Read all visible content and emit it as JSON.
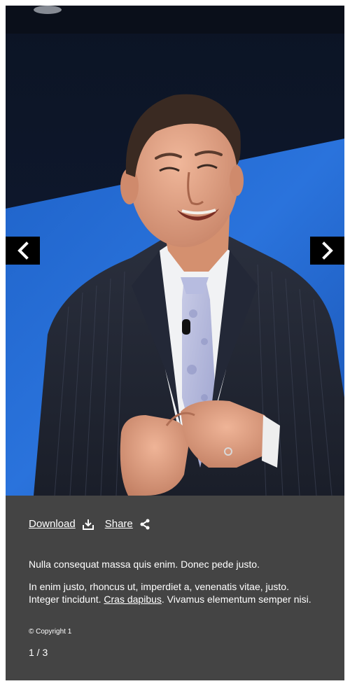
{
  "gallery": {
    "photo_alt": "Man in a pinstripe suit and paisley tie speaking on stage",
    "prev_icon": "chevron-left-icon",
    "next_icon": "chevron-right-icon",
    "actions": {
      "download_label": "Download",
      "download_icon": "download-icon",
      "share_label": "Share",
      "share_icon": "share-icon"
    },
    "caption": {
      "paragraph1": "Nulla consequat massa quis enim. Donec pede justo.",
      "paragraph2_before": "In enim justo, rhoncus ut, imperdiet a, venenatis vitae, justo. Integer tincidunt. ",
      "paragraph2_link": "Cras dapibus",
      "paragraph2_after": ". Vivamus elementum semper nisi."
    },
    "copyright": "© Copyright 1",
    "counter": "1 / 3",
    "colors": {
      "panel": "#444444",
      "nav_button": "#000000",
      "text": "#ffffff"
    }
  }
}
